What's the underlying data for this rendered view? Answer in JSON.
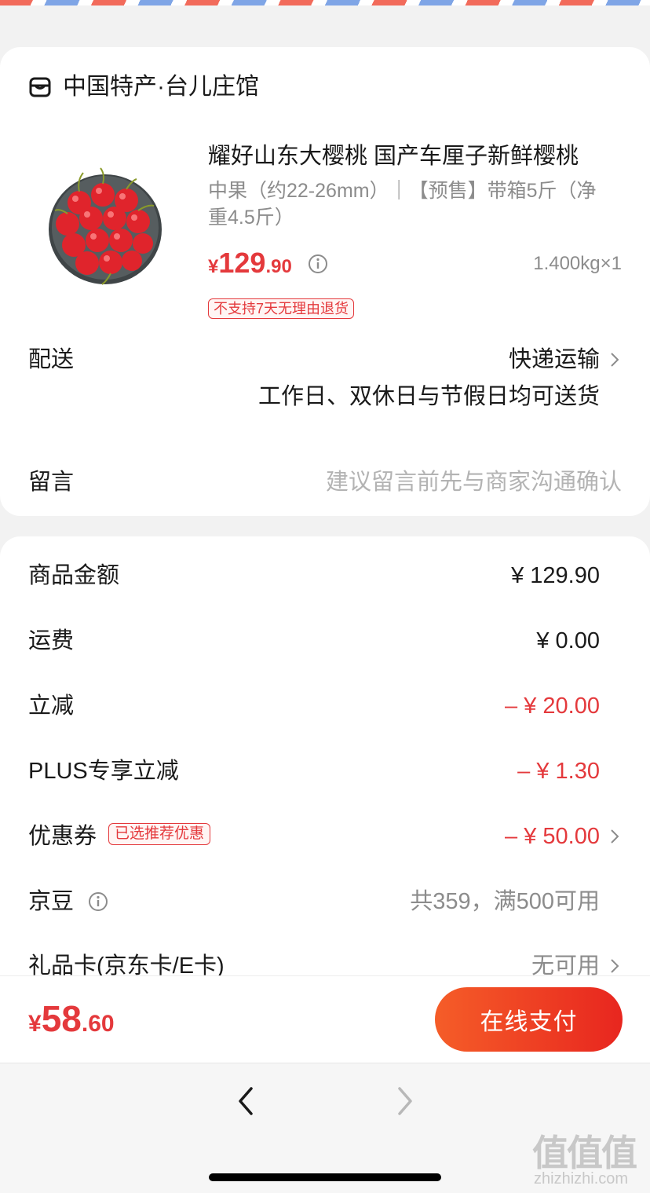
{
  "shop": {
    "icon": "shop-icon",
    "name": "中国特产·台儿庄馆"
  },
  "product": {
    "image": "cherry-bowl-image",
    "title": "耀好山东大樱桃 国产车厘子新鲜樱桃",
    "spec": "中果（约22-26mm）｜【预售】带箱5斤（净重4.5斤）",
    "price_currency": "¥",
    "price_int": "129",
    "price_dec": ".90",
    "weight_qty": "1.400kg×1",
    "return_tag": "不支持7天无理由退货"
  },
  "delivery": {
    "label": "配送",
    "method": "快递运输",
    "note": "工作日、双休日与节假日均可送货"
  },
  "message": {
    "label": "留言",
    "placeholder": "建议留言前先与商家沟通确认",
    "value": ""
  },
  "fees": {
    "goods_label": "商品金额",
    "goods_value": "¥ 129.90",
    "shipping_label": "运费",
    "shipping_value": "¥ 0.00",
    "discount_label": "立减",
    "discount_value": "– ¥ 20.00",
    "plus_label": "PLUS专享立减",
    "plus_value": "– ¥ 1.30",
    "coupon_label": "优惠券",
    "coupon_tag": "已选推荐优惠",
    "coupon_value": "– ¥ 50.00",
    "beans_label": "京豆",
    "beans_value": "共359，满500可用",
    "giftcard_label": "礼品卡(京东卡/E卡)",
    "giftcard_value": "无可用"
  },
  "pay": {
    "total_currency": "¥",
    "total_int": "58",
    "total_dec": ".60",
    "button_label": "在线支付"
  },
  "watermark": {
    "logo": "值值值",
    "url": "zhizhizhi.com"
  },
  "colors": {
    "price_red": "#e4393c",
    "pay_gradient_start": "#f55d28",
    "pay_gradient_end": "#e8261f",
    "muted_text": "#8c8c8c"
  }
}
